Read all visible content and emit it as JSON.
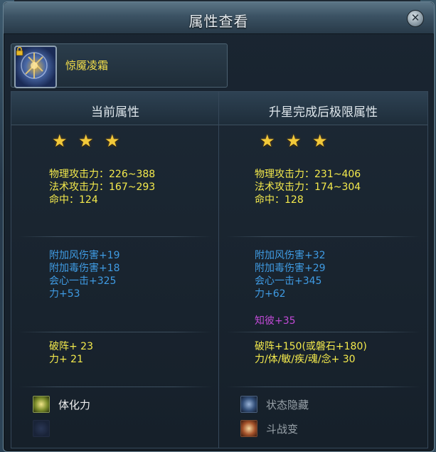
{
  "window": {
    "title": "属性查看"
  },
  "item": {
    "name": "惊魇凌霜"
  },
  "left": {
    "header": "当前属性",
    "stars": [
      "★",
      "★",
      "★"
    ],
    "base": [
      "物理攻击力：226~388",
      "法术攻击力：167~293",
      "命中：124"
    ],
    "bonus": [
      "附加风伤害+19",
      "附加毒伤害+18",
      "会心一击+325",
      "力+53"
    ],
    "extra": [
      "破阵+ 23",
      "力+ 21"
    ],
    "skills": [
      {
        "label": "体化力",
        "icon": "strength-skill-icon"
      },
      {
        "label": "",
        "icon": "empty-skill-icon"
      }
    ]
  },
  "right": {
    "header": "升星完成后极限属性",
    "stars": [
      "★",
      "★",
      "★"
    ],
    "base": [
      "物理攻击力：231~406",
      "法术攻击力：174~304",
      "命中：128"
    ],
    "bonus": [
      "附加风伤害+32",
      "附加毒伤害+29",
      "会心一击+345",
      "力+62"
    ],
    "special": "知彼+35",
    "extra": [
      "破阵+150(或磐石+180)",
      "力/体/敏/疾/魂/念+ 30"
    ],
    "skills": [
      {
        "label": "状态隐藏",
        "icon": "stealth-skill-icon"
      },
      {
        "label": "斗战变",
        "icon": "battle-transform-skill-icon"
      }
    ]
  },
  "colors": {
    "yellow": "#f4ea4c",
    "blue": "#3f9be3",
    "purple": "#c04ad6",
    "skill_active": "#f0f0f0",
    "skill_inactive": "#9aa3aa"
  }
}
